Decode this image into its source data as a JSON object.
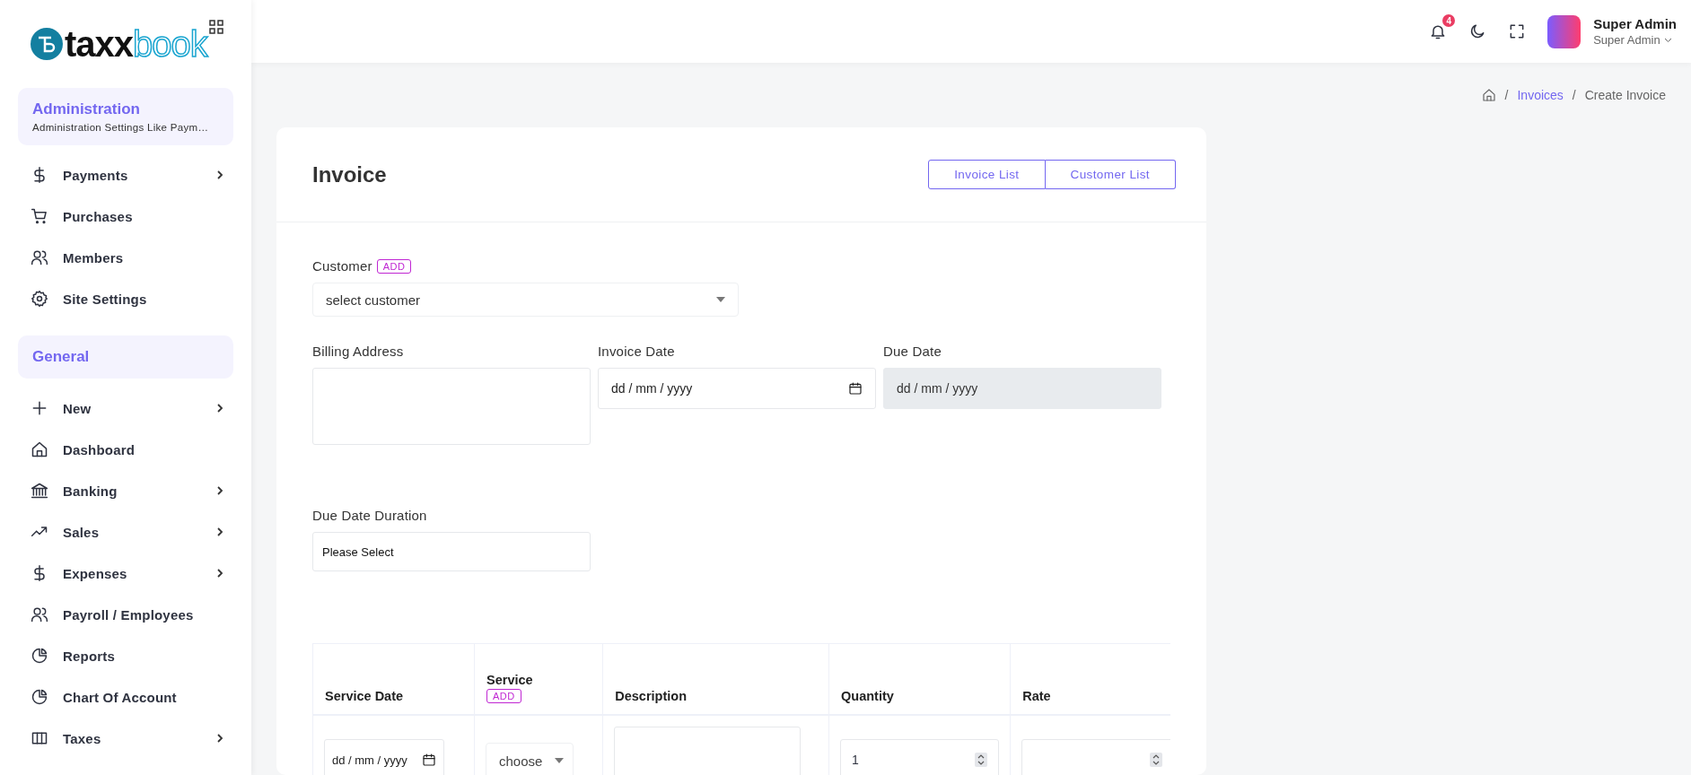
{
  "brand": {
    "name_dark": "taxx",
    "name_light": "book"
  },
  "sidebar": {
    "sections": [
      {
        "title": "Administration",
        "subtitle": "Administration Settings Like Paym…",
        "items": [
          {
            "label": "Payments",
            "kind": "dollar",
            "has_submenu": true
          },
          {
            "label": "Purchases",
            "kind": "cart",
            "has_submenu": false
          },
          {
            "label": "Members",
            "kind": "users",
            "has_submenu": false
          },
          {
            "label": "Site Settings",
            "kind": "gear",
            "has_submenu": false
          }
        ]
      },
      {
        "title": "General",
        "items": [
          {
            "label": "New",
            "kind": "plus",
            "has_submenu": true
          },
          {
            "label": "Dashboard",
            "kind": "home",
            "has_submenu": false
          },
          {
            "label": "Banking",
            "kind": "bank",
            "has_submenu": true
          },
          {
            "label": "Sales",
            "kind": "trend",
            "has_submenu": true
          },
          {
            "label": "Expenses",
            "kind": "dollar",
            "has_submenu": true
          },
          {
            "label": "Payroll / Employees",
            "kind": "users",
            "has_submenu": false
          },
          {
            "label": "Reports",
            "kind": "pie",
            "has_submenu": false
          },
          {
            "label": "Chart Of Account",
            "kind": "pie",
            "has_submenu": false
          },
          {
            "label": "Taxes",
            "kind": "grid",
            "has_submenu": true
          }
        ]
      }
    ]
  },
  "header": {
    "notification_count": "4",
    "user": {
      "name": "Super Admin",
      "role": "Super Admin"
    }
  },
  "breadcrumb": [
    {
      "separator": "/",
      "label": "Invoices",
      "kind": "link"
    },
    {
      "separator": "/",
      "label": "Create Invoice",
      "kind": "current"
    }
  ],
  "card": {
    "title": "Invoice",
    "buttons": [
      "Invoice List",
      "Customer List"
    ],
    "customer": {
      "label": "Customer",
      "add": "ADD",
      "placeholder": "select customer"
    },
    "dates_row": [
      {
        "label": "Billing Address",
        "kind": "textarea"
      },
      {
        "label": "Invoice Date",
        "kind": "date",
        "placeholder": "dd / mm / yyyy",
        "disabled": false
      },
      {
        "label": "Due Date",
        "kind": "date",
        "placeholder": "dd / mm / yyyy",
        "disabled": true
      }
    ],
    "due_date_duration": {
      "label": "Due Date Duration",
      "value": "Please Select"
    },
    "table": {
      "columns": [
        {
          "label": "Service Date"
        },
        {
          "label": "Service",
          "add": "ADD"
        },
        {
          "label": "Description"
        },
        {
          "label": "Quantity"
        },
        {
          "label": "Rate"
        }
      ],
      "rows": [
        {
          "service_date": "dd / mm / yyyy",
          "service": "choose",
          "description": "",
          "quantity": "1",
          "rate": ""
        }
      ]
    }
  }
}
